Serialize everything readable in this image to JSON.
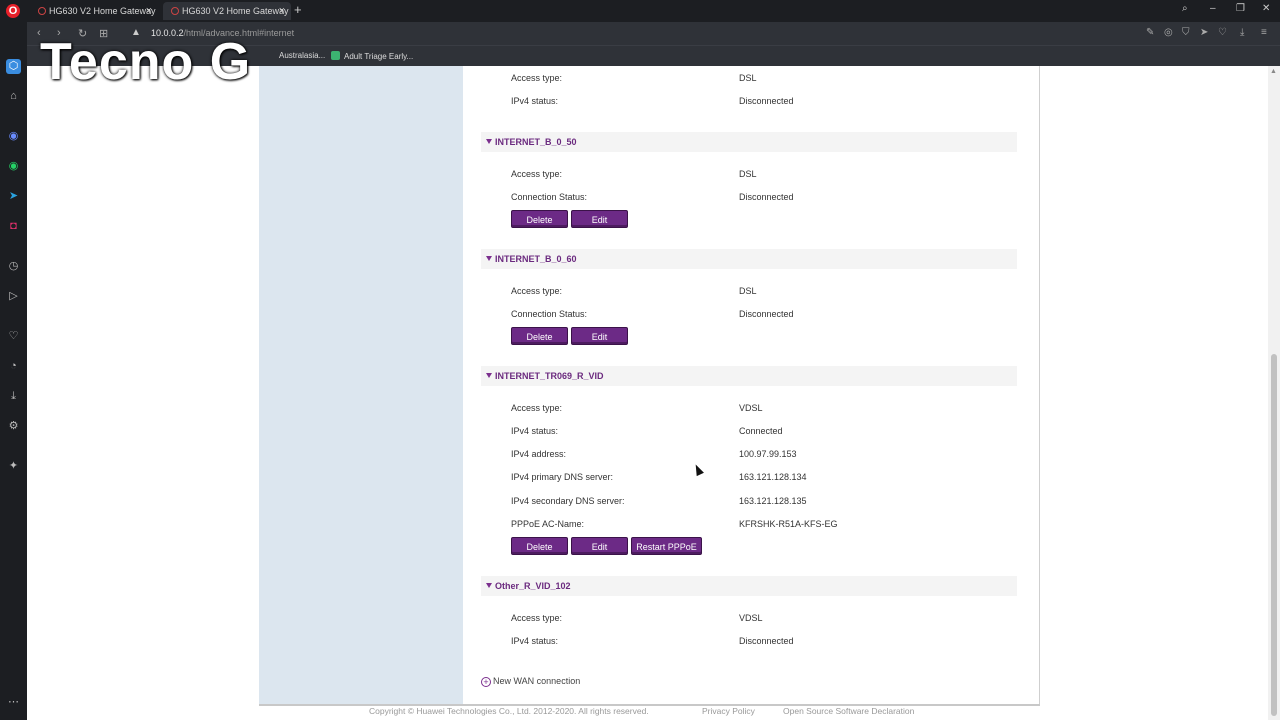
{
  "browser": {
    "tabs": [
      {
        "title": "HG630 V2 Home Gateway"
      },
      {
        "title": "HG630 V2 Home Gateway"
      }
    ],
    "url_host": "10.0.0.2",
    "url_path": "/html/advance.html#internet",
    "bookmarks": [
      "Australasia...",
      "Adult Triage Early..."
    ],
    "watermark": "Tecno G"
  },
  "sections": [
    {
      "title": "",
      "rows": [
        {
          "label": "Access type:",
          "value": "DSL"
        },
        {
          "label": "IPv4 status:",
          "value": "Disconnected"
        }
      ],
      "buttons": []
    },
    {
      "title": "INTERNET_B_0_50",
      "rows": [
        {
          "label": "Access type:",
          "value": "DSL"
        },
        {
          "label": "Connection Status:",
          "value": "Disconnected"
        }
      ],
      "buttons": [
        "Delete",
        "Edit"
      ]
    },
    {
      "title": "INTERNET_B_0_60",
      "rows": [
        {
          "label": "Access type:",
          "value": "DSL"
        },
        {
          "label": "Connection Status:",
          "value": "Disconnected"
        }
      ],
      "buttons": [
        "Delete",
        "Edit"
      ]
    },
    {
      "title": "INTERNET_TR069_R_VID",
      "rows": [
        {
          "label": "Access type:",
          "value": "VDSL"
        },
        {
          "label": "IPv4 status:",
          "value": "Connected"
        },
        {
          "label": "IPv4 address:",
          "value": "100.97.99.153"
        },
        {
          "label": "IPv4 primary DNS server:",
          "value": "163.121.128.134"
        },
        {
          "label": "IPv4 secondary DNS server:",
          "value": "163.121.128.135"
        },
        {
          "label": "PPPoE AC-Name:",
          "value": "KFRSHK-R51A-KFS-EG"
        }
      ],
      "buttons": [
        "Delete",
        "Edit",
        "Restart PPPoE"
      ]
    },
    {
      "title": "Other_R_VID_102",
      "rows": [
        {
          "label": "Access type:",
          "value": "VDSL"
        },
        {
          "label": "IPv4 status:",
          "value": "Disconnected"
        }
      ],
      "buttons": []
    }
  ],
  "new_wan_label": "New WAN connection",
  "footer": {
    "copyright": "Copyright © Huawei Technologies Co., Ltd. 2012-2020. All rights reserved.",
    "privacy": "Privacy Policy",
    "oss": "Open Source Software Declaration"
  },
  "colors": {
    "accent": "#6c2a86",
    "left_panel": "#dce6ef",
    "chrome": "#1c1e22"
  }
}
